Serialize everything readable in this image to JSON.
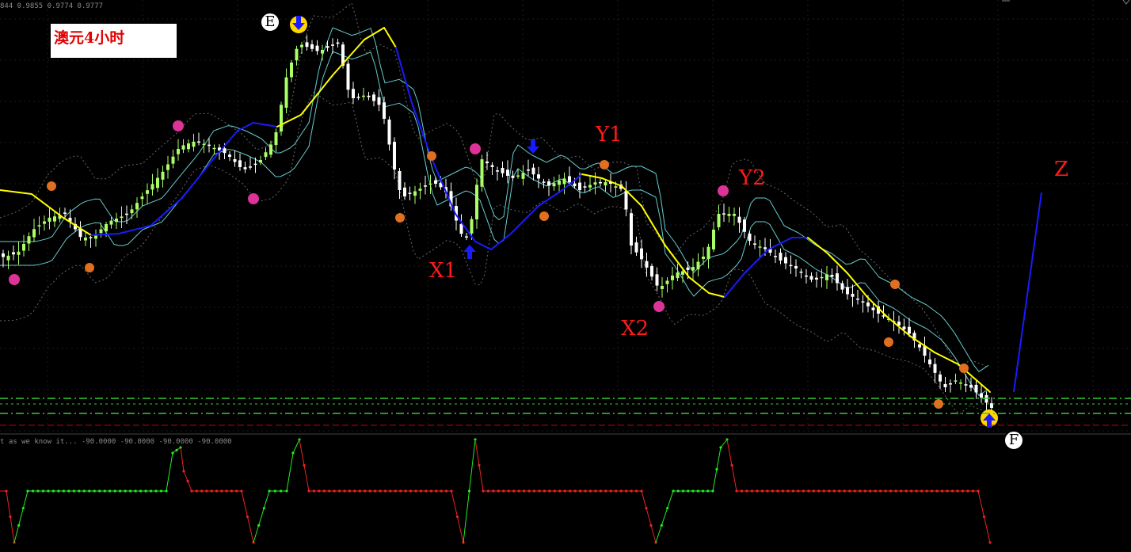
{
  "header": {
    "price_readout": "844 0.9855 0.9774 0.9777"
  },
  "title": "澳元4小时",
  "wave_labels": {
    "x1": "X1",
    "y1": "Y1",
    "x2": "X2",
    "y2": "Y2",
    "z": "Z"
  },
  "point_labels": {
    "e": "E",
    "f": "F"
  },
  "oscillator": {
    "readout": "t as we know it... -90.0000 -90.0000 -90.0000 -90.0000"
  },
  "colors": {
    "background": "#000000",
    "bull_candle": "#aaff66",
    "bear_candle": "#ffffff",
    "ma_up": "#1a1aff",
    "ma_down": "#ffff00",
    "envelope": "#66cccc",
    "bands": "#666666",
    "label_red": "#ff1a1a",
    "support_green": "#33cc33",
    "support_red": "#cc0000",
    "osc_up": "#22ee22",
    "osc_down": "#ee2222",
    "fractal_orange": "#e07020",
    "fractal_magenta": "#dd3399"
  },
  "icons": {
    "sell_arrow": "arrow-down-icon",
    "buy_arrow": "arrow-up-icon",
    "fractal": "fractal-dot-icon"
  }
}
